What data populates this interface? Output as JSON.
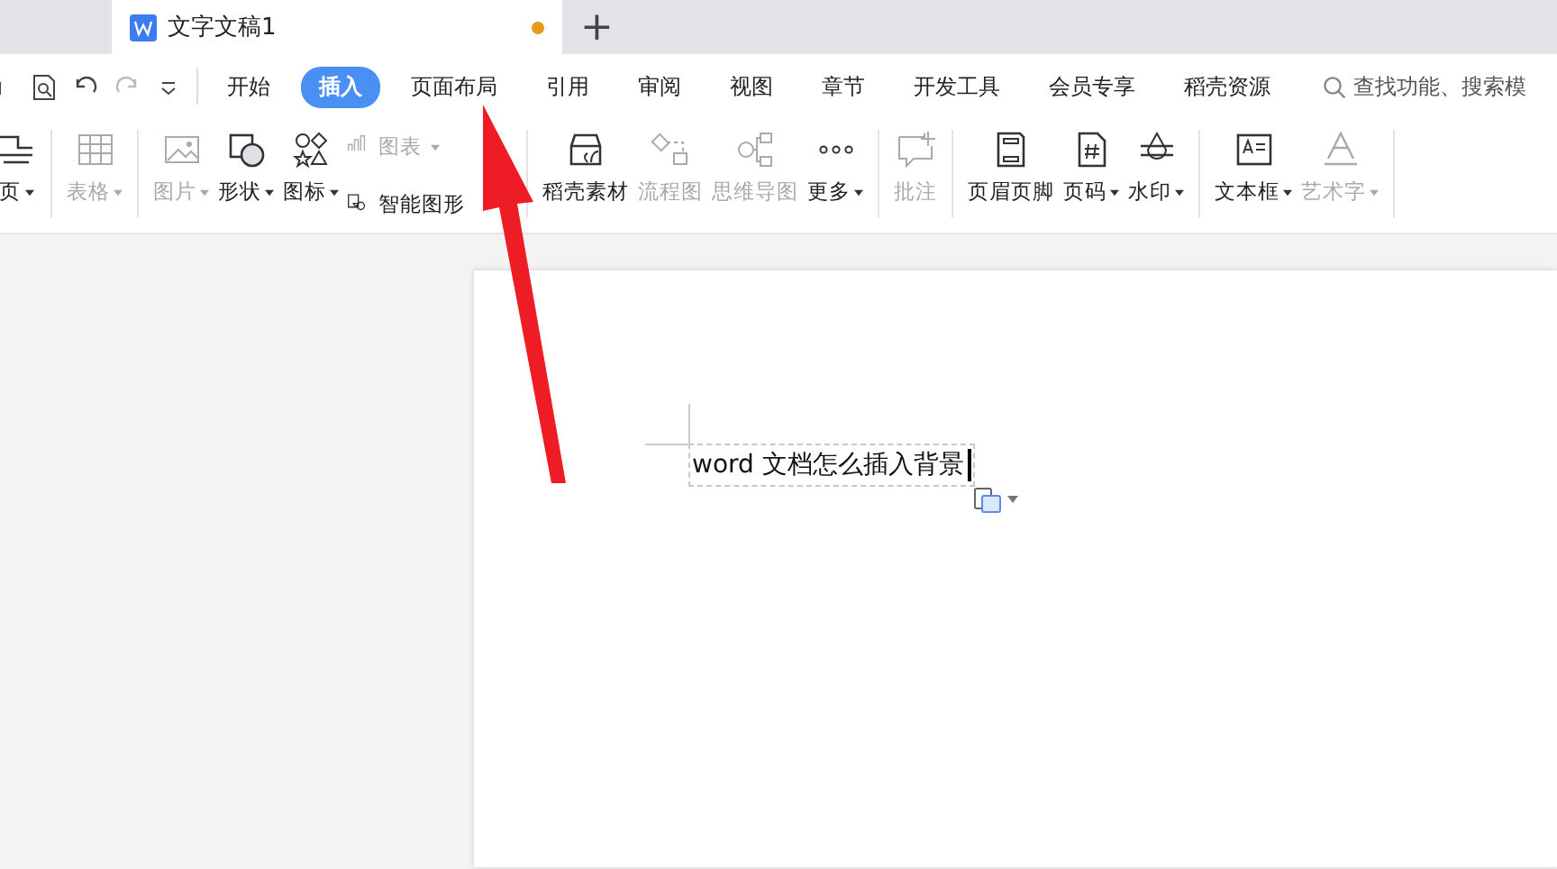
{
  "tabs": [
    {
      "title": "文字文稿1",
      "selected": true,
      "unsaved": true
    }
  ],
  "new_tab": "+",
  "menu": [
    {
      "label": "开始",
      "selected": false
    },
    {
      "label": "插入",
      "selected": true
    },
    {
      "label": "页面布局",
      "selected": false
    },
    {
      "label": "引用",
      "selected": false
    },
    {
      "label": "审阅",
      "selected": false
    },
    {
      "label": "视图",
      "selected": false
    },
    {
      "label": "章节",
      "selected": false
    },
    {
      "label": "开发工具",
      "selected": false
    },
    {
      "label": "会员专享",
      "selected": false
    },
    {
      "label": "稻壳资源",
      "selected": false
    }
  ],
  "search": {
    "placeholder": "查找功能、搜索模"
  },
  "ribbon": [
    [
      {
        "label": "页",
        "caret": true,
        "disabled": false
      }
    ],
    [
      {
        "label": "表格",
        "caret": true,
        "disabled": true
      }
    ],
    [
      {
        "label": "图片",
        "caret": true,
        "disabled": true
      },
      {
        "label": "形状",
        "caret": true,
        "disabled": false
      },
      {
        "label": "图标",
        "caret": true,
        "disabled": false
      },
      {
        "kind": "stack",
        "items": [
          {
            "label": "图表",
            "caret": true,
            "disabled": true
          },
          {
            "label": "智能图形",
            "caret": false,
            "disabled": false
          }
        ]
      }
    ],
    [
      {
        "label": "稻壳素材",
        "caret": false,
        "disabled": false
      },
      {
        "label": "流程图",
        "caret": false,
        "disabled": true
      },
      {
        "label": "思维导图",
        "caret": false,
        "disabled": true
      },
      {
        "label": "更多",
        "caret": true,
        "disabled": false
      }
    ],
    [
      {
        "label": "批注",
        "caret": false,
        "disabled": true
      }
    ],
    [
      {
        "label": "页眉页脚",
        "caret": false,
        "disabled": false
      },
      {
        "label": "页码",
        "caret": true,
        "disabled": false
      },
      {
        "label": "水印",
        "caret": true,
        "disabled": false
      }
    ],
    [
      {
        "label": "文本框",
        "caret": true,
        "disabled": false
      },
      {
        "label": "艺术字",
        "caret": true,
        "disabled": true
      }
    ]
  ],
  "document": {
    "text": "word 文档怎么插入背景"
  },
  "annotation": {
    "kind": "arrow"
  }
}
